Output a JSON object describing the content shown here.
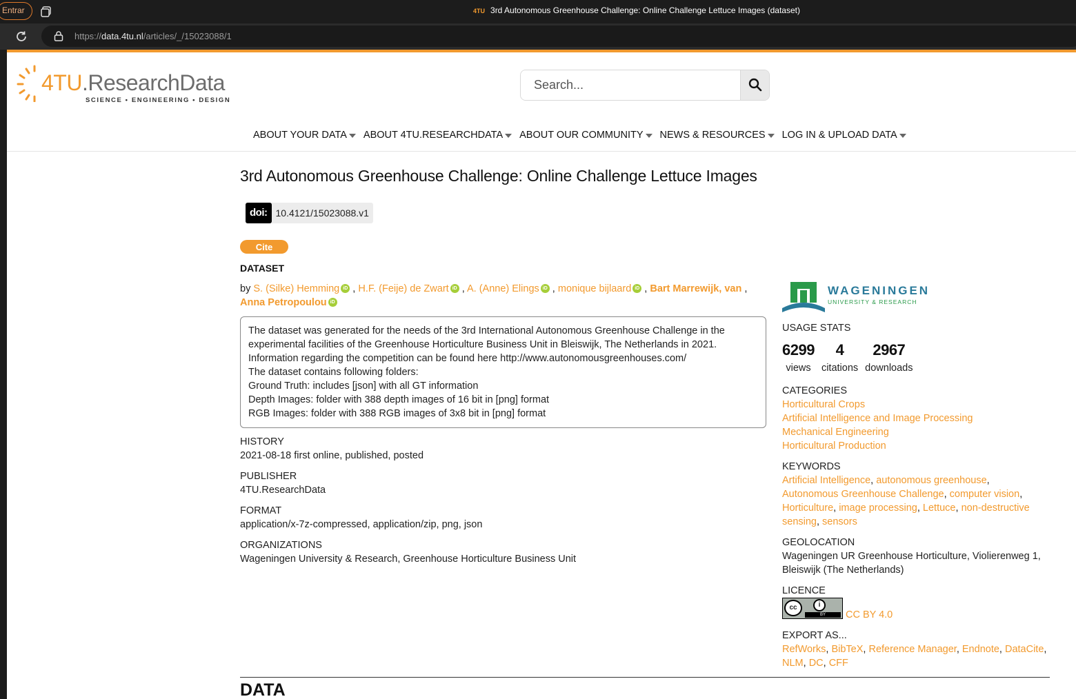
{
  "browser": {
    "profile_button": "Entrar",
    "tab_favicon": "4TU",
    "tab_title": "3rd Autonomous Greenhouse Challenge: Online Challenge Lettuce Images (dataset)",
    "url_prefix": "https://",
    "url_host": "data.4tu.nl",
    "url_path": "/articles/_/15023088/1"
  },
  "header": {
    "logo_main": "4TU",
    "logo_rest": ".ResearchData",
    "logo_tagline": "SCIENCE • ENGINEERING • DESIGN",
    "search_placeholder": "Search...",
    "nav": [
      {
        "label": "ABOUT YOUR DATA"
      },
      {
        "label": "ABOUT 4TU.RESEARCHDATA"
      },
      {
        "label": "ABOUT OUR COMMUNITY"
      },
      {
        "label": "NEWS & RESOURCES"
      },
      {
        "label": "LOG IN & UPLOAD DATA"
      }
    ]
  },
  "article": {
    "title": "3rd Autonomous Greenhouse Challenge: Online Challenge Lettuce Images",
    "doi_tag": "doi:",
    "doi": "10.4121/15023088.v1",
    "cite_label": "Cite",
    "type_label": "DATASET",
    "by": "by",
    "authors": [
      {
        "name": "S. (Silke) Hemming",
        "sep": " , "
      },
      {
        "name": "H.F. (Feije) de Zwart",
        "sep": " , "
      },
      {
        "name": "A. (Anne) Elings",
        "sep": " , "
      },
      {
        "name": "monique bijlaard",
        "sep": " , "
      },
      {
        "name": "Bart Marrewijk, van",
        "sep": " ,"
      },
      {
        "name": "Anna Petropoulou",
        "sep": ""
      }
    ],
    "description": [
      "The dataset was generated for the needs of the 3rd International Autonomous Greenhouse Challenge in the experimental facilities of the Greenhouse Horticulture Business Unit in Bleiswijk, The Netherlands in 2021.",
      "Information regarding the competition can be found here http://www.autonomousgreenhouses.com/",
      "The dataset contains following folders:",
      "Ground Truth: includes [json] with all GT information",
      "Depth Images: folder with 388 depth images of 16 bit in [png] format",
      "RGB Images: folder with 388 RGB images of 3x8 bit in [png] format"
    ],
    "history_label": "HISTORY",
    "history": "2021-08-18 first online, published, posted",
    "publisher_label": "PUBLISHER",
    "publisher": "4TU.ResearchData",
    "format_label": "FORMAT",
    "format": "application/x-7z-compressed, application/zip, png, json",
    "organizations_label": "ORGANIZATIONS",
    "organizations": "Wageningen University & Research, Greenhouse Horticulture Business Unit",
    "data_heading": "DATA"
  },
  "sidebar": {
    "wur_name": "WAGENINGEN",
    "wur_sub": "UNIVERSITY & RESEARCH",
    "usage_label": "USAGE STATS",
    "stats": [
      {
        "value": "6299",
        "label": "views"
      },
      {
        "value": "4",
        "label": "citations"
      },
      {
        "value": "2967",
        "label": "downloads"
      }
    ],
    "categories_label": "CATEGORIES",
    "categories": [
      "Horticultural Crops",
      "Artificial Intelligence and Image Processing",
      "Mechanical Engineering",
      "Horticultural Production"
    ],
    "keywords_label": "KEYWORDS",
    "keywords": [
      "Artificial Intelligence",
      "autonomous greenhouse",
      "Autonomous Greenhouse Challenge",
      "computer vision",
      "Horticulture",
      "image processing",
      "Lettuce",
      "non-destructive sensing",
      "sensors"
    ],
    "geolocation_label": "GEOLOCATION",
    "geolocation_line1": "Wageningen UR Greenhouse Horticulture, Violierenweg 1,",
    "geolocation_line2": "Bleiswijk (The Netherlands)",
    "licence_label": "LICENCE",
    "licence_cc": "cc",
    "licence_by_mark": "BY",
    "licence": "CC BY 4.0",
    "export_label": "EXPORT AS...",
    "exports": [
      "RefWorks",
      "BibTeX",
      "Reference Manager",
      "Endnote",
      "DataCite",
      "NLM",
      "DC",
      "CFF"
    ]
  },
  "colors": {
    "accent": "#f29a2e",
    "orcid": "#a6ce39",
    "wur_blue": "#2a7a9a",
    "wur_green": "#2a9a4a"
  },
  "icons": {
    "tabs": "tab-actions-icon",
    "reload": "reload-icon",
    "lock": "lock-icon",
    "search": "search-icon",
    "orcid": "orcid-icon",
    "caret": "caret-down-icon"
  }
}
